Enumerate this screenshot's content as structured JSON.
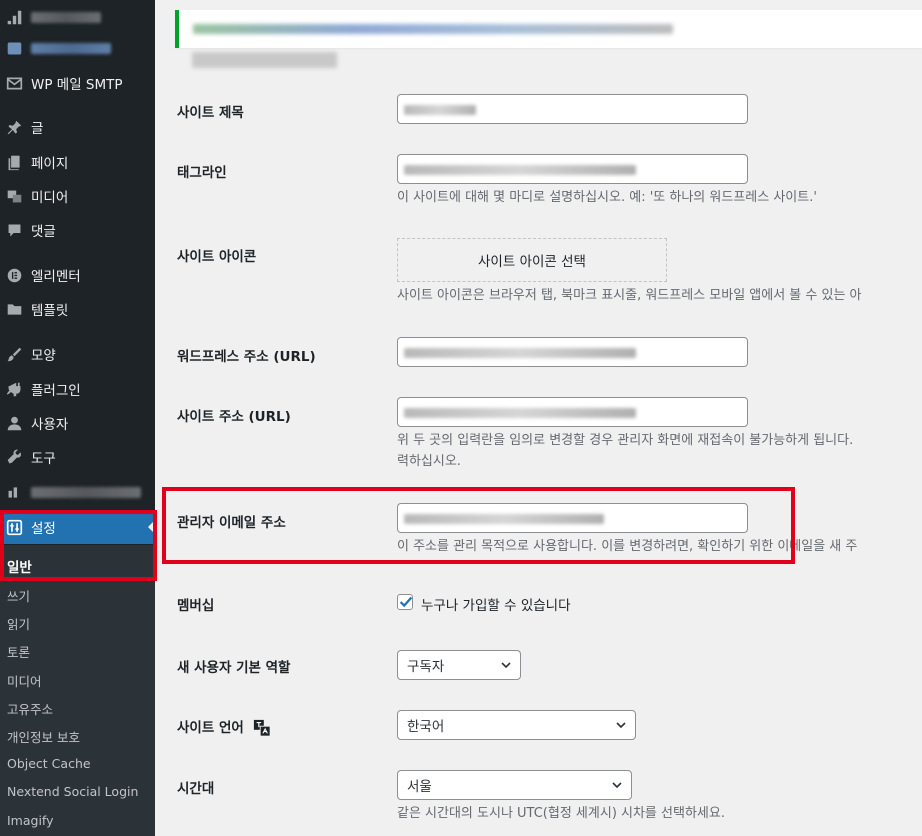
{
  "sidebar": {
    "items": [
      {
        "label": "WP 메일 SMTP",
        "icon": "mail-icon"
      },
      {
        "label": "글",
        "icon": "pin-icon"
      },
      {
        "label": "페이지",
        "icon": "pages-icon"
      },
      {
        "label": "미디어",
        "icon": "media-icon"
      },
      {
        "label": "댓글",
        "icon": "comment-icon"
      },
      {
        "label": "엘리멘터",
        "icon": "elementor-icon"
      },
      {
        "label": "템플릿",
        "icon": "folder-icon"
      },
      {
        "label": "모양",
        "icon": "brush-icon"
      },
      {
        "label": "플러그인",
        "icon": "plugin-icon"
      },
      {
        "label": "사용자",
        "icon": "user-icon"
      },
      {
        "label": "도구",
        "icon": "wrench-icon"
      },
      {
        "label": "설정",
        "icon": "settings-icon"
      }
    ],
    "submenu": [
      "일반",
      "쓰기",
      "읽기",
      "토론",
      "미디어",
      "고유주소",
      "개인정보 보호",
      "Object Cache",
      "Nextend Social Login",
      "Imagify"
    ]
  },
  "form": {
    "site_title_label": "사이트 제목",
    "tagline_label": "태그라인",
    "tagline_desc": "이 사이트에 대해 몇 마디로 설명하십시오. 예: '또 하나의 워드프레스 사이트.'",
    "site_icon_label": "사이트 아이콘",
    "site_icon_button": "사이트 아이콘 선택",
    "site_icon_desc": "사이트 아이콘은 브라우저 탭, 북마크 표시줄, 워드프레스 모바일 앱에서 볼 수 있는 아",
    "wp_url_label": "워드프레스 주소 (URL)",
    "site_url_label": "사이트 주소 (URL)",
    "url_desc_1": "위 두 곳의 입력란을 임의로 변경할 경우 관리자 화면에 재접속이 불가능하게 됩니다.",
    "url_desc_2": "력하십시오.",
    "admin_email_label": "관리자 이메일 주소",
    "admin_email_desc": "이 주소를 관리 목적으로 사용합니다. 이를 변경하려면, 확인하기 위한 이메일을 새 주",
    "membership_label": "멤버십",
    "membership_check": "누구나 가입할 수 있습니다",
    "default_role_label": "새 사용자 기본 역할",
    "default_role_value": "구독자",
    "site_language_label": "사이트 언어",
    "site_language_value": "한국어",
    "timezone_label": "시간대",
    "timezone_value": "서울",
    "timezone_desc": "같은 시간대의 도시나 UTC(협정 세계시) 시차를 선택하세요."
  },
  "colors": {
    "highlight": "#e0001b",
    "accent": "#2271b1",
    "sidebar": "#1d2327"
  }
}
